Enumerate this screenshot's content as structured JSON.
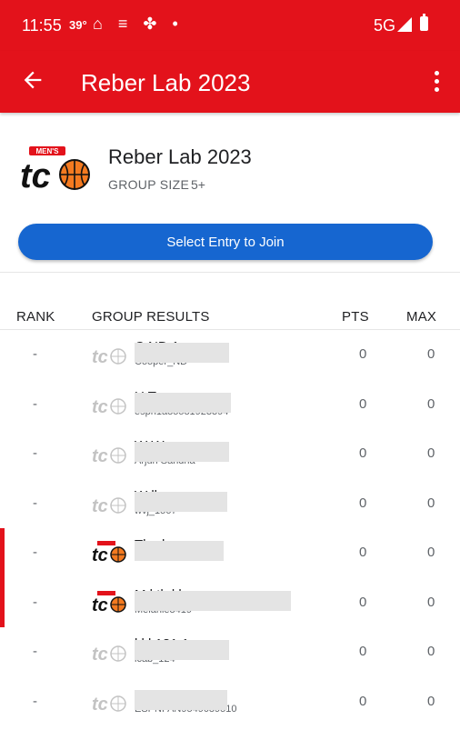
{
  "status": {
    "time": "11:55",
    "temp": "39°",
    "icons": "⌂ ≡ ✤ •",
    "network": "5G"
  },
  "app_bar": {
    "title": "Reber Lab 2023"
  },
  "group": {
    "name": "Reber Lab 2023",
    "size_label": "GROUP SIZE",
    "size_value": "5+",
    "join_label": "Select Entry to Join",
    "logo_text": "MEN'S"
  },
  "table": {
    "headers": {
      "rank": "RANK",
      "group": "GROUP RESULTS",
      "pts": "PTS",
      "max": "MAX"
    },
    "rows": [
      {
        "rank": "-",
        "name": "C      ND 1",
        "user": "Cooper_ND",
        "pts": "0",
        "max": "0",
        "highlight": false
      },
      {
        "rank": "-",
        "name": "U    T",
        "user": "espn1a85581923394",
        "pts": "0",
        "max": "0",
        "highlight": false
      },
      {
        "rank": "-",
        "name": "W     W",
        "user": "Arjun Sandha",
        "pts": "0",
        "max": "0",
        "highlight": false
      },
      {
        "rank": "-",
        "name": "W ll",
        "user": "wvj_1567",
        "pts": "0",
        "max": "0",
        "highlight": false
      },
      {
        "rank": "-",
        "name": "The h r",
        "user": "",
        "pts": "0",
        "max": "0",
        "highlight": true
      },
      {
        "rank": "-",
        "name": "M l                th   l     k",
        "user": "Melanie8419",
        "pts": "0",
        "max": "0",
        "highlight": true
      },
      {
        "rank": "-",
        "name": "l  l l 131 1",
        "user": "lcab_124",
        "pts": "0",
        "max": "0",
        "highlight": false
      },
      {
        "rank": "-",
        "name": "",
        "user": "ESPNFAN9549089510",
        "pts": "0",
        "max": "0",
        "highlight": false
      }
    ]
  },
  "colors": {
    "brand_red": "#e3121b",
    "button_blue": "#1666d0"
  }
}
